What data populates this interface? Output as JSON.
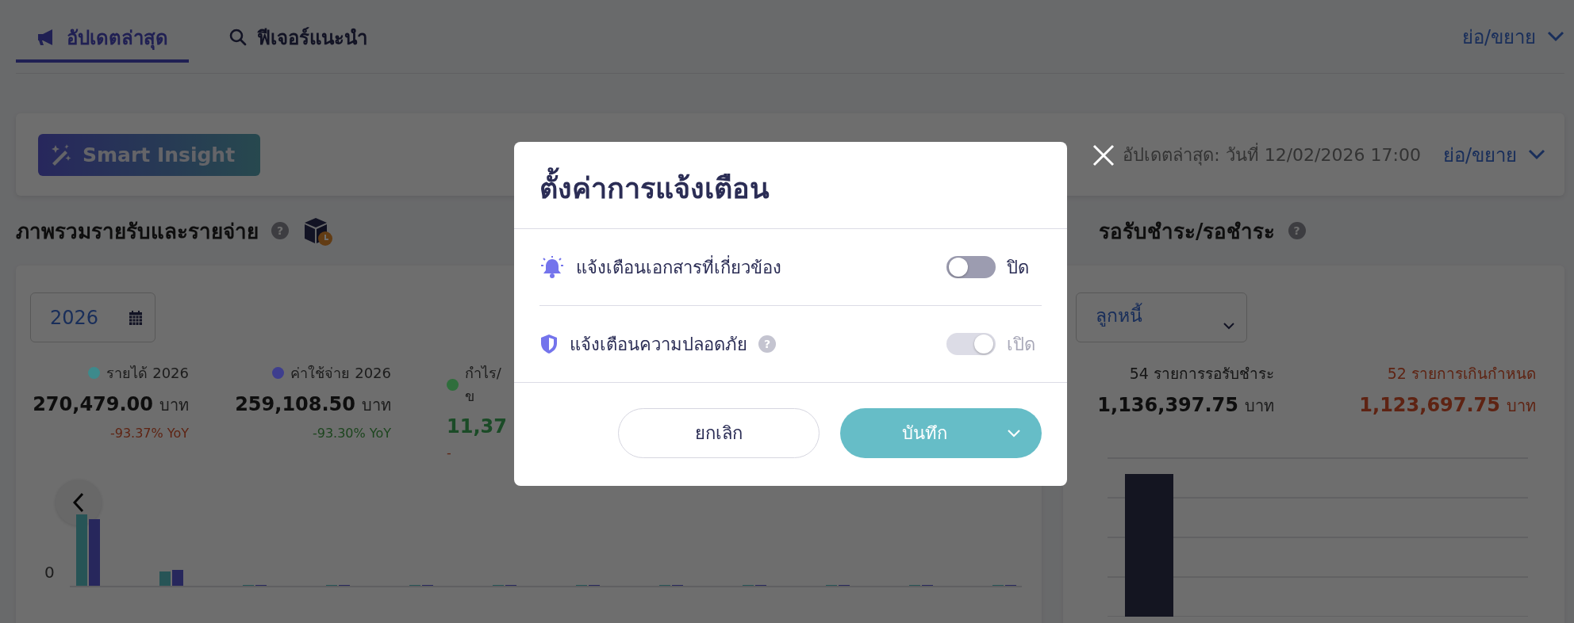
{
  "tabs": [
    {
      "label": "อัปเดตล่าสุด",
      "selected": true
    },
    {
      "label": "ฟีเจอร์แนะนำ",
      "selected": false
    }
  ],
  "top_toggle": "ย่อ/ขยาย",
  "insight": {
    "button": "Smart Insight",
    "updated": "อัปเดตล่าสุด: วันที่ 12/02/2026 17:00",
    "toggle": "ย่อ/ขยาย"
  },
  "overview": {
    "title": "ภาพรวมรายรับและรายจ่าย",
    "help": "?",
    "year": "2026",
    "axis_label": "0",
    "stats": [
      {
        "label": "รายได้ 2026",
        "color": "#3d8a8c",
        "amount": "270,479.00",
        "unit": "บาท",
        "change": "-93.37% YoY",
        "favorable": false
      },
      {
        "label": "ค่าใช้จ่าย 2026",
        "color": "#3e3e8e",
        "amount": "259,108.50",
        "unit": "บาท",
        "change": "-93.30% YoY",
        "favorable": true
      },
      {
        "label": "กำไร/ข",
        "color": "#2f6e3c",
        "amount": "11,37",
        "change": "-",
        "favorable": false
      }
    ]
  },
  "receivables": {
    "title": "รอรับชำระ/รอชำระ",
    "help": "?",
    "filter": "ลูกหนี้",
    "stats": [
      {
        "label": "54 รายการรอรับชำระ",
        "amount": "1,136,397.75",
        "unit": "บาท",
        "overdue": false
      },
      {
        "label": "52 รายการเกินกำหนด",
        "amount": "1,123,697.75",
        "unit": "บาท",
        "overdue": true
      }
    ]
  },
  "dialog": {
    "title": "ตั้งค่าการแจ้งเตือน",
    "cancel": "ยกเลิก",
    "save": "บันทึก",
    "settings": [
      {
        "label": "แจ้งเตือนเอกสารที่เกี่ยวข้อง",
        "on": false,
        "disabled": false,
        "status": "ปิด"
      },
      {
        "label": "แจ้งเตือนความปลอดภัย",
        "help": "?",
        "on": true,
        "disabled": true,
        "status": "เปิด"
      }
    ]
  }
}
